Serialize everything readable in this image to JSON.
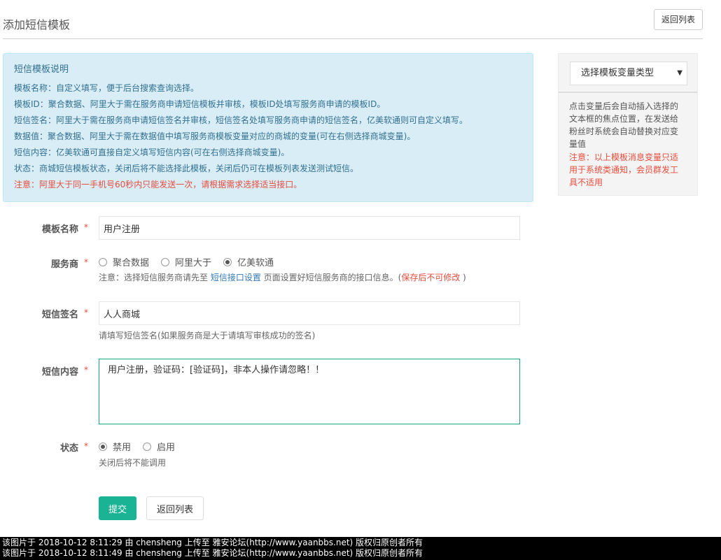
{
  "header": {
    "title": "添加短信模板",
    "back_button": "返回列表"
  },
  "info": {
    "title": "短信模板说明",
    "lines": [
      "模板名称：自定义填写，便于后台搜索查询选择。",
      "模板ID：聚合数据、阿里大于需在服务商申请短信模板并审核，模板ID处填写服务商申请的模板ID。",
      "短信签名：阿里大于需在服务商申请短信签名并审核，短信签名处填写服务商申请的短信签名，亿美软通则可自定义填写。",
      "数据值：聚合数据、阿里大于需在数据值中填写服务商模板变量对应的商城的变量(可在右侧选择商城变量)。",
      "短信内容：亿美软通可直接自定义填写短信内容(可在右侧选择商城变量)。",
      "状态：商城短信模板状态，关闭后将不能选择此模板，关闭后仍可在模板列表发送测试短信。"
    ],
    "warning": "注意：阿里大于同一手机号60秒内只能发送一次，请根据需求选择适当接口。"
  },
  "side_panel": {
    "select_label": "选择模板变量类型",
    "description": "点击变量后会自动插入选择的文本框的焦点位置，在发送给粉丝时系统会自动替换对应变量值",
    "warning": "注意：以上模板消息变量只适用于系统类通知，会员群发工具不适用"
  },
  "form": {
    "required_mark": "*",
    "name": {
      "label": "模板名称",
      "value": "用户注册"
    },
    "provider": {
      "label": "服务商",
      "options": [
        "聚合数据",
        "阿里大于",
        "亿美软通"
      ],
      "selected": "亿美软通",
      "help_prefix": "注意：选择短信服务商请先至 ",
      "help_link": "短信接口设置",
      "help_middle": " 页面设置好短信服务商的接口信息。(",
      "help_red": "保存后不可修改",
      "help_suffix": " )"
    },
    "signature": {
      "label": "短信签名",
      "value": "人人商城",
      "help": "请填写短信签名(如果服务商是大于请填写审核成功的签名)"
    },
    "content": {
      "label": "短信内容",
      "value": "用户注册，验证码：[验证码]，非本人操作请忽略！！"
    },
    "status": {
      "label": "状态",
      "options": [
        "禁用",
        "启用"
      ],
      "selected": "禁用",
      "help": "关闭后将不能调用"
    },
    "submit": "提交",
    "back": "返回列表"
  },
  "footer": {
    "lines": [
      "该图片于 2018-10-12 8:11:29 由 chensheng 上传至 雅安论坛(http://www.yaanbbs.net) 版权归原创者所有",
      "该图片于 2018-10-12 8:11:49 由 chensheng 上传至 雅安论坛(http://www.yaanbbs.net) 版权归原创者所有"
    ]
  }
}
